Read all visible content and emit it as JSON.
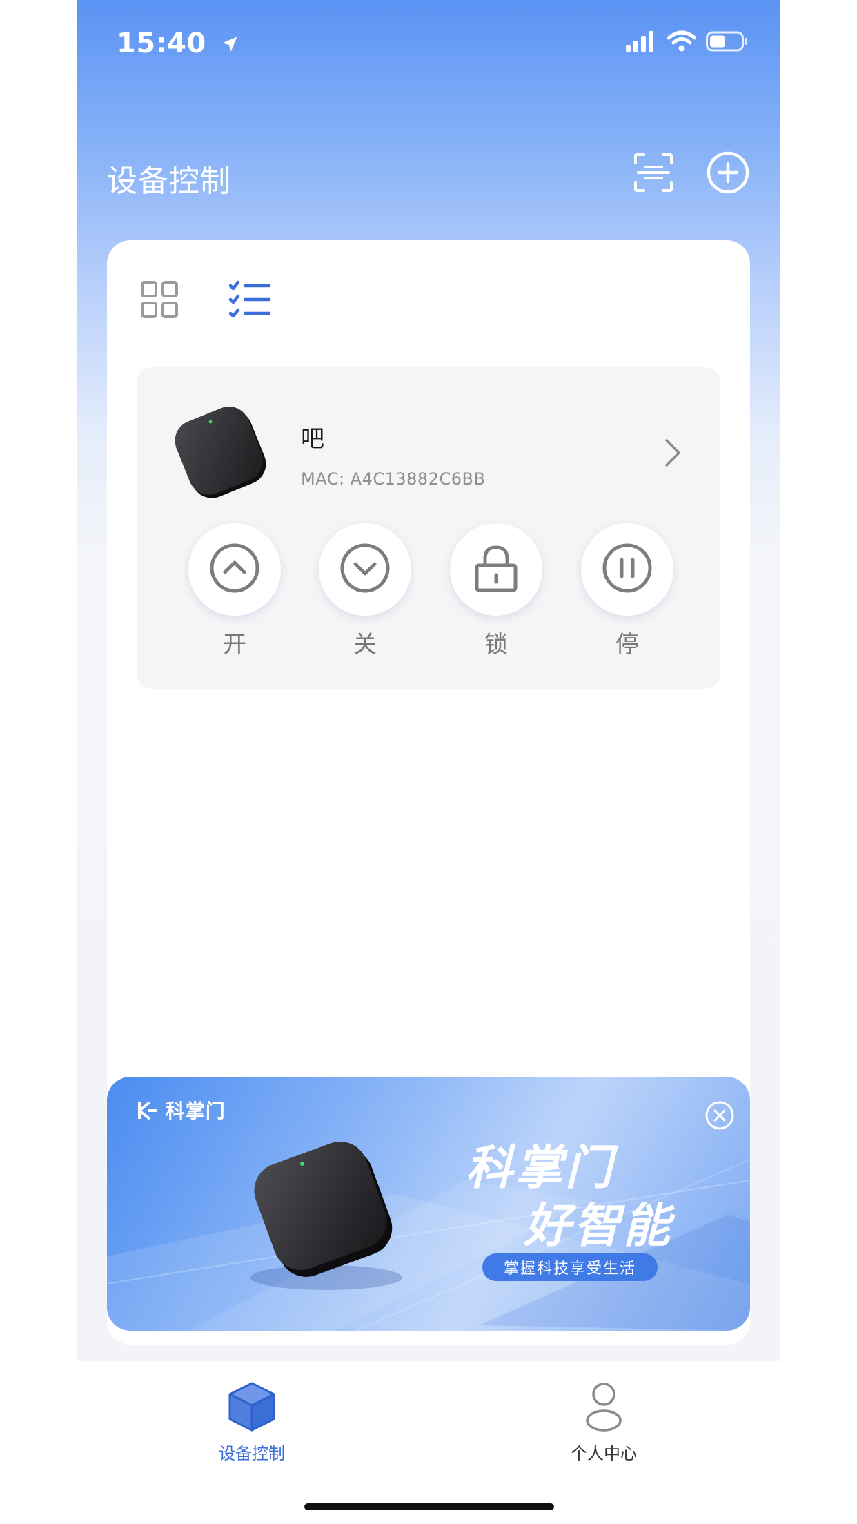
{
  "status_bar": {
    "time": "15:40",
    "icons": [
      "location-arrow-icon",
      "signal-icon",
      "wifi-icon",
      "battery-icon"
    ]
  },
  "header": {
    "title": "设备控制",
    "icons": [
      "scan-icon",
      "add-circle-icon"
    ]
  },
  "view_toggle": {
    "options": [
      "grid-view-icon",
      "list-view-icon"
    ],
    "active": "list-view-icon"
  },
  "device": {
    "name": "吧",
    "mac": "MAC: A4C13882C6BB",
    "controls": [
      {
        "icon": "chevron-up-circle-icon",
        "label": "开"
      },
      {
        "icon": "chevron-down-circle-icon",
        "label": "关"
      },
      {
        "icon": "lock-icon",
        "label": "锁"
      },
      {
        "icon": "pause-icon",
        "label": "停"
      }
    ]
  },
  "banner": {
    "logo": "科掌门",
    "headline_line1": "科掌门",
    "headline_line2": "好智能",
    "tagline": "掌握科技享受生活"
  },
  "tabbar": {
    "items": [
      {
        "label": "设备控制",
        "icon": "cube-icon",
        "active": true
      },
      {
        "label": "个人中心",
        "icon": "person-icon",
        "active": false
      }
    ]
  },
  "colors": {
    "accent": "#3b6fd8",
    "header_gradient_top": "#5b93f4",
    "control_gray": "#777777"
  }
}
